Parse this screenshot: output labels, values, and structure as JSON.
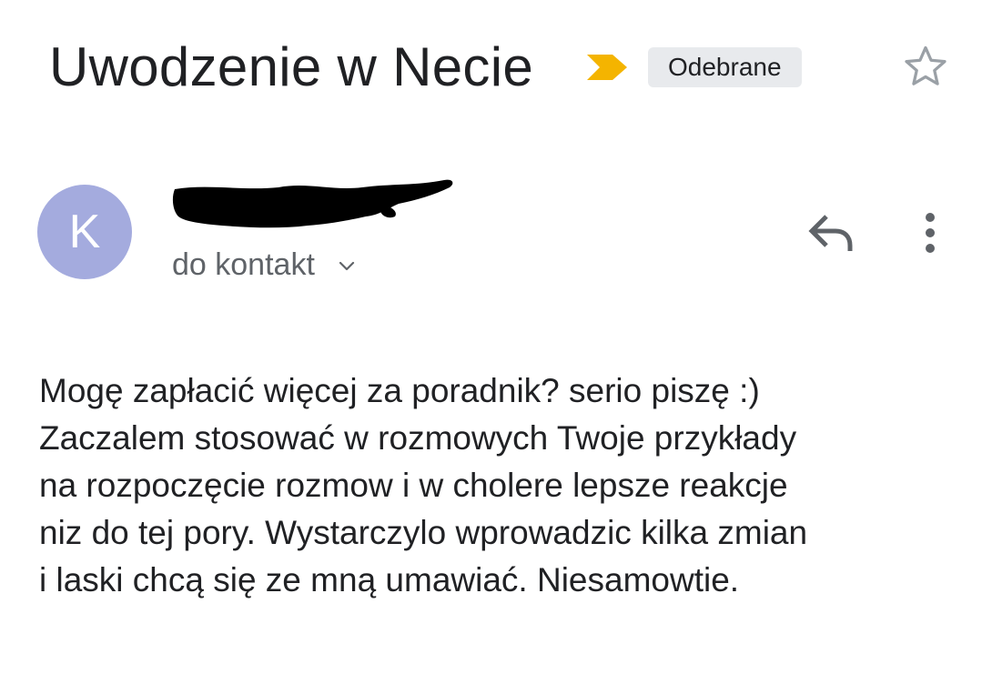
{
  "email": {
    "subject": "Uwodzenie w Necie",
    "importance_icon": "important-marker-icon",
    "label": "Odebrane",
    "star_icon": "star-outline-icon",
    "sender": {
      "avatar_letter": "K",
      "avatar_color": "#a4abde",
      "name_redacted": true
    },
    "recipient_text": "do kontakt",
    "recipient_toggle_icon": "chevron-down-icon",
    "actions": {
      "reply_icon": "reply-icon",
      "more_icon": "more-vertical-icon"
    },
    "body_lines": [
      "Mogę zapłacić więcej za poradnik? serio piszę :)",
      "Zaczalem stosować w rozmowych Twoje przykłady",
      "na rozpoczęcie rozmow i w cholere lepsze reakcje",
      "niz do tej pory. Wystarczylo wprowadzic kilka zmian",
      "i laski chcą się ze mną umawiać. Niesamowtie."
    ]
  },
  "colors": {
    "important_marker": "#f4b400",
    "label_chip_bg": "#e8eaed",
    "secondary_text": "#5f6368",
    "primary_text": "#202124",
    "icon_gray": "#5f6368",
    "star_outline": "#9aa0a6"
  }
}
